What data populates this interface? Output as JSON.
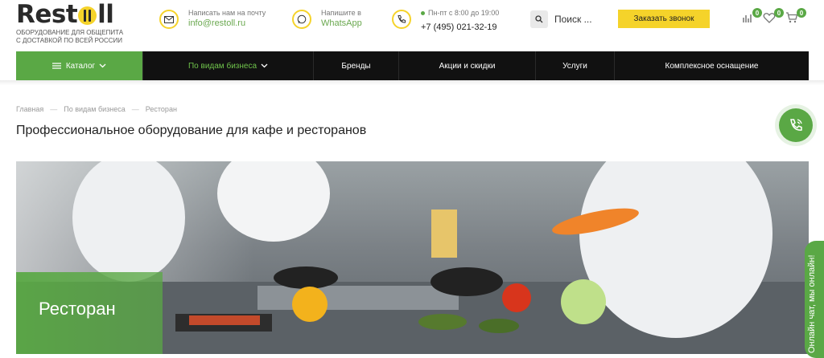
{
  "header": {
    "logo_text": "Restoll",
    "tagline_line1": "ОБОРУДОВАНИЕ ДЛЯ ОБЩЕПИТА",
    "tagline_line2": "С ДОСТАВКОЙ ПО ВСЕЙ РОССИИ",
    "email_caption": "Написать нам на почту",
    "email": "info@restoll.ru",
    "whatsapp_caption": "Напишите в",
    "whatsapp": "WhatsApp",
    "hours": "Пн-пт с 8:00 до 19:00",
    "phone": "+7 (495) 021-32-19",
    "search_placeholder": "Поиск ...",
    "callback_label": "Заказать звонок",
    "compare_count": "0",
    "favorites_count": "0",
    "cart_count": "0"
  },
  "nav": {
    "catalog": "Каталог",
    "business": "По видам бизнеса",
    "brands": "Бренды",
    "sales": "Акции и скидки",
    "services": "Услуги",
    "complex": "Комплексное оснащение"
  },
  "breadcrumb": [
    "Главная",
    "По видам бизнеса",
    "Ресторан"
  ],
  "breadcrumb_sep": "—",
  "page": {
    "title": "Профессиональное оборудование для кафе и ресторанов",
    "hero_label": "Ресторан"
  },
  "chat": {
    "label": "Онлайн чат, мы онлайн!"
  },
  "colors": {
    "accent_green": "#5aa845",
    "accent_yellow": "#f5d32a",
    "nav_bg": "#111111"
  }
}
